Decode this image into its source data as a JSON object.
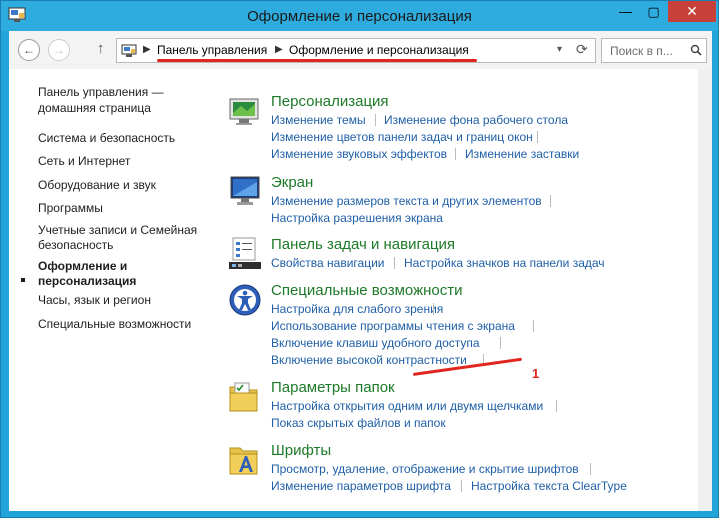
{
  "window": {
    "title": "Оформление и персонализация",
    "minimize": "—",
    "maximize": "▢",
    "close": "✕"
  },
  "nav": {
    "back": "←",
    "forward": "→",
    "up": "↑",
    "breadcrumb": [
      "Панель управления",
      "Оформление и персонализация"
    ],
    "separator": "▶",
    "dropdown": "▾",
    "refresh": "⟳",
    "search_placeholder": "Поиск в п..."
  },
  "sidebar": {
    "items": [
      "Панель управления —",
      "домашняя страница",
      "Система и безопасность",
      "Сеть и Интернет",
      "Оборудование и звук",
      "Программы",
      "Учетные записи и Семейная",
      "безопасность",
      "Оформление и",
      "персонализация",
      "Часы, язык и регион",
      "Специальные возможности"
    ]
  },
  "categories": [
    {
      "title": "Персонализация",
      "icon": "personalization-icon",
      "links": [
        "Изменение темы",
        "Изменение фона рабочего стола",
        "Изменение цветов панели задач и границ окон",
        "Изменение звуковых эффектов",
        "Изменение заставки"
      ]
    },
    {
      "title": "Экран",
      "icon": "display-icon",
      "links": [
        "Изменение размеров текста и других элементов",
        "Настройка разрешения экрана"
      ]
    },
    {
      "title": "Панель задач и навигация",
      "icon": "taskbar-icon",
      "links": [
        "Свойства навигации",
        "Настройка значков на панели задач"
      ]
    },
    {
      "title": "Специальные возможности",
      "icon": "ease-of-access-icon",
      "links": [
        "Настройка для слабого зрения",
        "Использование программы чтения с экрана",
        "Включение клавиш удобного доступа",
        "Включение высокой контрастности"
      ]
    },
    {
      "title": "Параметры папок",
      "icon": "folder-options-icon",
      "links": [
        "Настройка открытия одним или двумя щелчками",
        "Показ скрытых файлов и папок"
      ]
    },
    {
      "title": "Шрифты",
      "icon": "fonts-icon",
      "links": [
        "Просмотр, удаление, отображение и скрытие шрифтов",
        "Изменение параметров шрифта",
        "Настройка текста ClearType"
      ]
    }
  ],
  "annotation": {
    "number": "1",
    "color": "#e0261e"
  },
  "colors": {
    "accent": "#22a3d9",
    "link": "#1f5fa7",
    "category": "#1d7a28",
    "close": "#c7413a"
  }
}
